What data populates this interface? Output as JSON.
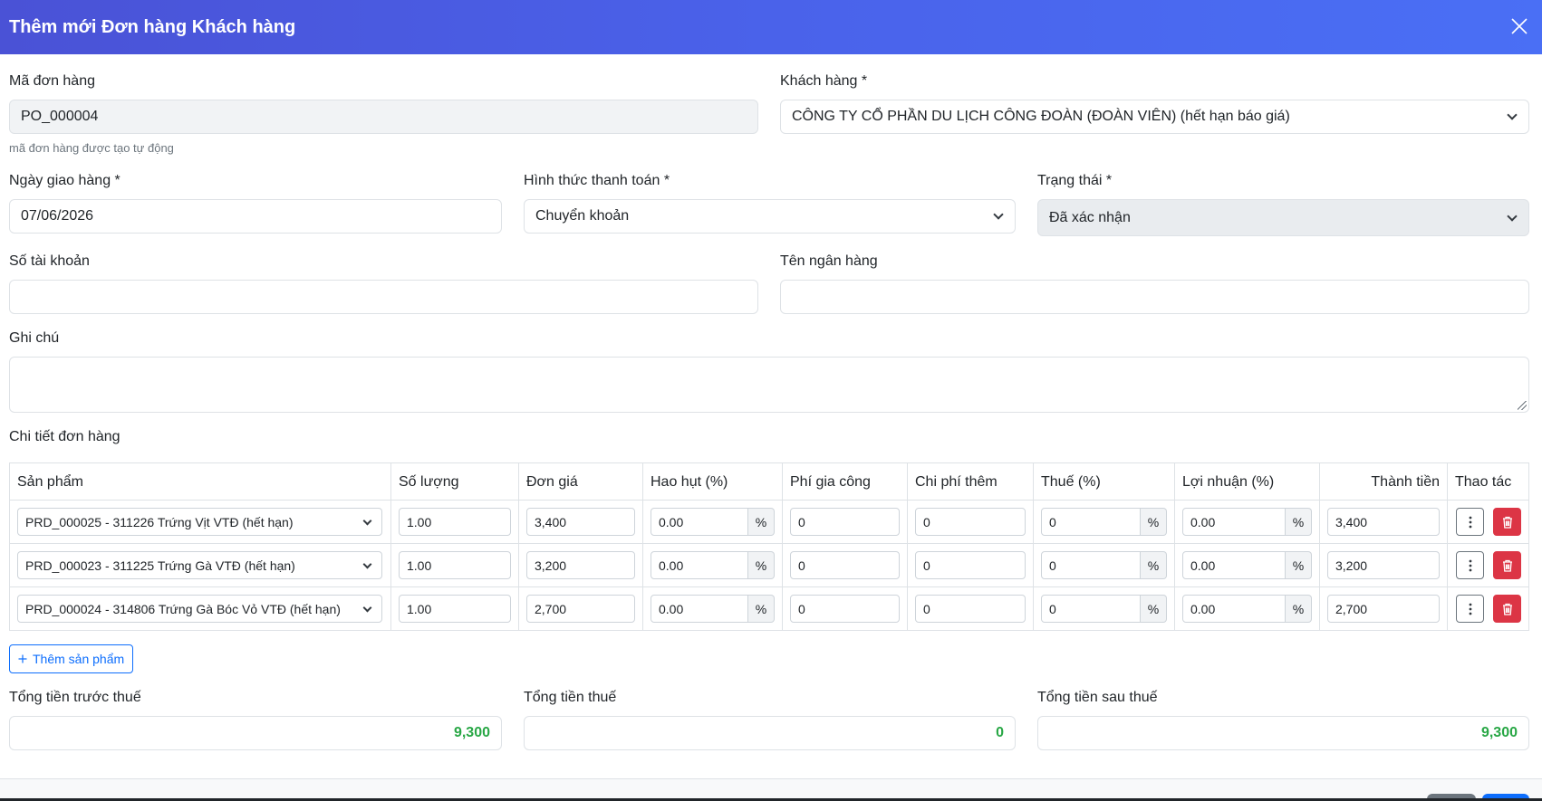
{
  "modal": {
    "title": "Thêm mới Đơn hàng Khách hàng"
  },
  "form": {
    "order_code_label": "Mã đơn hàng",
    "order_code_value": "PO_000004",
    "order_code_help": "mã đơn hàng được tạo tự động",
    "customer_label": "Khách hàng *",
    "customer_value": "CÔNG TY CỔ PHẦN DU LỊCH CÔNG ĐOÀN (ĐOÀN VIÊN) (hết hạn báo giá)",
    "delivery_date_label": "Ngày giao hàng *",
    "delivery_date_value": "07/06/2026",
    "payment_label": "Hình thức thanh toán *",
    "payment_value": "Chuyển khoản",
    "status_label": "Trạng thái *",
    "status_value": "Đã xác nhận",
    "account_label": "Số tài khoản",
    "account_value": "",
    "bank_label": "Tên ngân hàng",
    "bank_value": "",
    "note_label": "Ghi chú",
    "note_value": ""
  },
  "details": {
    "section_title": "Chi tiết đơn hàng",
    "columns": [
      "Sản phẩm",
      "Số lượng",
      "Đơn giá",
      "Hao hụt (%)",
      "Phí gia công",
      "Chi phí thêm",
      "Thuế (%)",
      "Lợi nhuận (%)",
      "Thành tiền",
      "Thao tác"
    ],
    "percent_symbol": "%",
    "rows": [
      {
        "product": "PRD_000025 - 311226 Trứng Vịt VTĐ (hết hạn)",
        "qty": "1.00",
        "price": "3,400",
        "loss": "0.00",
        "processing": "0",
        "extra": "0",
        "tax": "0",
        "profit": "0.00",
        "total": "3,400"
      },
      {
        "product": "PRD_000023 - 311225 Trứng Gà VTĐ (hết hạn)",
        "qty": "1.00",
        "price": "3,200",
        "loss": "0.00",
        "processing": "0",
        "extra": "0",
        "tax": "0",
        "profit": "0.00",
        "total": "3,200"
      },
      {
        "product": "PRD_000024 - 314806 Trứng Gà Bóc Vỏ VTĐ (hết hạn)",
        "qty": "1.00",
        "price": "2,700",
        "loss": "0.00",
        "processing": "0",
        "extra": "0",
        "tax": "0",
        "profit": "0.00",
        "total": "2,700"
      }
    ],
    "add_product_label": "Thêm sản phẩm"
  },
  "totals": {
    "before_tax_label": "Tổng tiền trước thuế",
    "before_tax_value": "9,300",
    "tax_label": "Tổng tiền thuế",
    "tax_value": "0",
    "after_tax_label": "Tổng tiền sau thuế",
    "after_tax_value": "9,300"
  },
  "colors": {
    "header_start": "#4a52d6",
    "header_end": "#4a6ff5",
    "total_green": "#28a745",
    "danger": "#dc3545",
    "primary": "#0d6efd"
  }
}
